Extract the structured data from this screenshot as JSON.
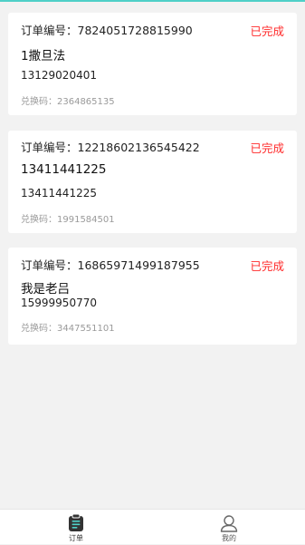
{
  "orders": [
    {
      "order_line": "订单编号：7824051728815990",
      "status": "已完成",
      "name": "1撒旦法",
      "phone": "13129020401",
      "code_line": "兑换码：2364865135"
    },
    {
      "order_line": "订单编号：12218602136545422",
      "status": "已完成",
      "name": "13411441225",
      "phone": "13411441225",
      "code_line": "兑换码：1991584501"
    },
    {
      "order_line": "订单编号：16865971499187955",
      "status": "已完成",
      "name": "我是老吕",
      "phone": "15999950770",
      "code_line": "兑换码：3447551101"
    }
  ],
  "tabbar": {
    "tabs": [
      {
        "label": "订单",
        "icon": "order-list-icon",
        "active": true
      },
      {
        "label": "我的",
        "icon": "user-icon",
        "active": false
      }
    ]
  },
  "colors": {
    "status": "#ff2a2a",
    "accent": "#4fd0c8",
    "background": "#f2f2f2"
  }
}
